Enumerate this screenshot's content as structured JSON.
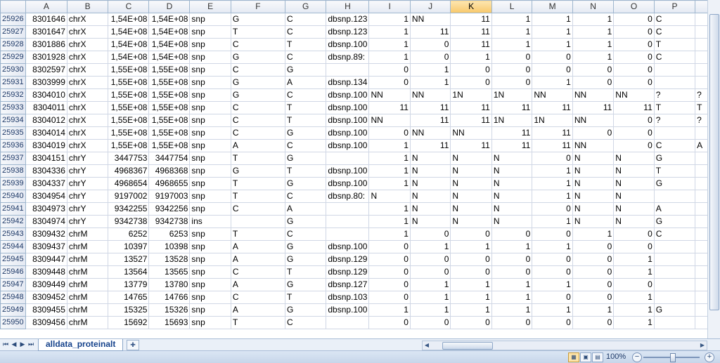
{
  "columns": [
    "A",
    "B",
    "C",
    "D",
    "E",
    "F",
    "G",
    "H",
    "I",
    "J",
    "K",
    "L",
    "M",
    "N",
    "O",
    "P",
    ""
  ],
  "selected_column": "K",
  "rows": [
    [
      "25926",
      "8301646",
      "chrX",
      "1,54E+08",
      "1,54E+08",
      "snp",
      "G",
      "C",
      "dbsnp.123",
      "1",
      "NN",
      "11",
      "1",
      "1",
      "1",
      "0",
      "C",
      ""
    ],
    [
      "25927",
      "8301647",
      "chrX",
      "1,54E+08",
      "1,54E+08",
      "snp",
      "T",
      "C",
      "dbsnp.123",
      "1",
      "11",
      "11",
      "1",
      "1",
      "1",
      "0",
      "C",
      ""
    ],
    [
      "25928",
      "8301886",
      "chrX",
      "1,54E+08",
      "1,54E+08",
      "snp",
      "C",
      "T",
      "dbsnp.100",
      "1",
      "0",
      "11",
      "1",
      "1",
      "1",
      "0",
      "T",
      ""
    ],
    [
      "25929",
      "8301928",
      "chrX",
      "1,54E+08",
      "1,54E+08",
      "snp",
      "G",
      "C",
      "dbsnp.89:",
      "1",
      "0",
      "1",
      "0",
      "0",
      "1",
      "0",
      "C",
      ""
    ],
    [
      "25930",
      "8302597",
      "chrX",
      "1,55E+08",
      "1,55E+08",
      "snp",
      "C",
      "G",
      "",
      "0",
      "1",
      "0",
      "0",
      "0",
      "0",
      "0",
      "",
      ""
    ],
    [
      "25931",
      "8303999",
      "chrX",
      "1,55E+08",
      "1,55E+08",
      "snp",
      "G",
      "A",
      "dbsnp.134",
      "0",
      "1",
      "0",
      "0",
      "1",
      "0",
      "0",
      "",
      ""
    ],
    [
      "25932",
      "8304010",
      "chrX",
      "1,55E+08",
      "1,55E+08",
      "snp",
      "G",
      "C",
      "dbsnp.100",
      "NN",
      "NN",
      "1N",
      "1N",
      "NN",
      "NN",
      "NN",
      "?",
      "?"
    ],
    [
      "25933",
      "8304011",
      "chrX",
      "1,55E+08",
      "1,55E+08",
      "snp",
      "C",
      "T",
      "dbsnp.100",
      "11",
      "11",
      "11",
      "11",
      "11",
      "11",
      "11",
      "T",
      "T"
    ],
    [
      "25934",
      "8304012",
      "chrX",
      "1,55E+08",
      "1,55E+08",
      "snp",
      "C",
      "T",
      "dbsnp.100",
      "NN",
      "11",
      "11",
      "1N",
      "1N",
      "NN",
      "0",
      "?",
      "?"
    ],
    [
      "25935",
      "8304014",
      "chrX",
      "1,55E+08",
      "1,55E+08",
      "snp",
      "C",
      "G",
      "dbsnp.100",
      "0",
      "NN",
      "NN",
      "11",
      "11",
      "0",
      "0",
      "",
      ""
    ],
    [
      "25936",
      "8304019",
      "chrX",
      "1,55E+08",
      "1,55E+08",
      "snp",
      "A",
      "C",
      "dbsnp.100",
      "1",
      "11",
      "11",
      "11",
      "11",
      "NN",
      "0",
      "C",
      "A"
    ],
    [
      "25937",
      "8304151",
      "chrY",
      "3447753",
      "3447754",
      "snp",
      "T",
      "G",
      "",
      "1",
      "N",
      "N",
      "N",
      "0",
      "N",
      "N",
      "G",
      ""
    ],
    [
      "25938",
      "8304336",
      "chrY",
      "4968367",
      "4968368",
      "snp",
      "G",
      "T",
      "dbsnp.100",
      "1",
      "N",
      "N",
      "N",
      "1",
      "N",
      "N",
      "T",
      ""
    ],
    [
      "25939",
      "8304337",
      "chrY",
      "4968654",
      "4968655",
      "snp",
      "T",
      "G",
      "dbsnp.100",
      "1",
      "N",
      "N",
      "N",
      "1",
      "N",
      "N",
      "G",
      ""
    ],
    [
      "25940",
      "8304954",
      "chrY",
      "9197002",
      "9197003",
      "snp",
      "T",
      "C",
      "dbsnp.80:",
      "N",
      "N",
      "N",
      "N",
      "1",
      "N",
      "N",
      "",
      ""
    ],
    [
      "25941",
      "8304973",
      "chrY",
      "9342255",
      "9342256",
      "snp",
      "C",
      "A",
      "",
      "1",
      "N",
      "N",
      "N",
      "0",
      "N",
      "N",
      "A",
      ""
    ],
    [
      "25942",
      "8304974",
      "chrY",
      "9342738",
      "9342738",
      "ins",
      "",
      "G",
      "",
      "1",
      "N",
      "N",
      "N",
      "1",
      "N",
      "N",
      "G",
      ""
    ],
    [
      "25943",
      "8309432",
      "chrM",
      "6252",
      "6253",
      "snp",
      "T",
      "C",
      "",
      "1",
      "0",
      "0",
      "0",
      "0",
      "1",
      "0",
      "C",
      ""
    ],
    [
      "25944",
      "8309437",
      "chrM",
      "10397",
      "10398",
      "snp",
      "A",
      "G",
      "dbsnp.100",
      "0",
      "1",
      "1",
      "1",
      "1",
      "0",
      "0",
      "",
      ""
    ],
    [
      "25945",
      "8309447",
      "chrM",
      "13527",
      "13528",
      "snp",
      "A",
      "G",
      "dbsnp.129",
      "0",
      "0",
      "0",
      "0",
      "0",
      "0",
      "1",
      "",
      ""
    ],
    [
      "25946",
      "8309448",
      "chrM",
      "13564",
      "13565",
      "snp",
      "C",
      "T",
      "dbsnp.129",
      "0",
      "0",
      "0",
      "0",
      "0",
      "0",
      "1",
      "",
      ""
    ],
    [
      "25947",
      "8309449",
      "chrM",
      "13779",
      "13780",
      "snp",
      "A",
      "G",
      "dbsnp.127",
      "0",
      "1",
      "1",
      "1",
      "1",
      "0",
      "0",
      "",
      ""
    ],
    [
      "25948",
      "8309452",
      "chrM",
      "14765",
      "14766",
      "snp",
      "C",
      "T",
      "dbsnp.103",
      "0",
      "1",
      "1",
      "1",
      "0",
      "0",
      "1",
      "",
      ""
    ],
    [
      "25949",
      "8309455",
      "chrM",
      "15325",
      "15326",
      "snp",
      "A",
      "G",
      "dbsnp.100",
      "1",
      "1",
      "1",
      "1",
      "1",
      "1",
      "1",
      "G",
      ""
    ],
    [
      "25950",
      "8309456",
      "chrM",
      "15692",
      "15693",
      "snp",
      "T",
      "C",
      "",
      "0",
      "0",
      "0",
      "0",
      "0",
      "0",
      "1",
      "",
      ""
    ]
  ],
  "sheet_tab": "alldata_proteinalt",
  "zoom": "100%"
}
